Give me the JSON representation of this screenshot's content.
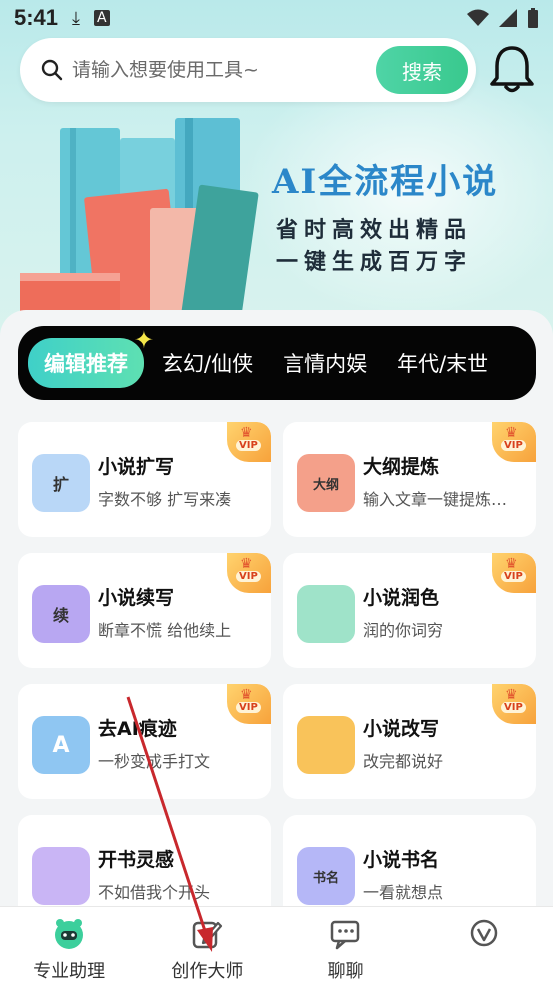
{
  "status_bar": {
    "time": "5:41"
  },
  "search": {
    "placeholder": "请输入想要使用工具~",
    "button_label": "搜索"
  },
  "banner": {
    "title": "AI全流程小说",
    "line1": "省时高效出精品",
    "line2": "一键生成百万字"
  },
  "tabs": [
    {
      "label": "编辑推荐",
      "active": true
    },
    {
      "label": "玄幻/仙侠"
    },
    {
      "label": "言情内娱"
    },
    {
      "label": "年代/末世"
    }
  ],
  "cards": [
    {
      "title": "小说扩写",
      "desc": "字数不够 扩写来凑",
      "badge": "VIP",
      "thumb_text": "扩",
      "thumb_color": "#b9d7f7"
    },
    {
      "title": "大纲提炼",
      "desc": "输入文章一键提炼…",
      "badge": "VIP",
      "thumb_text": "大纲",
      "thumb_color": "#f4a08a"
    },
    {
      "title": "小说续写",
      "desc": "断章不慌 给他续上",
      "badge": "VIP",
      "thumb_text": "续",
      "thumb_color": "#b8a7f2"
    },
    {
      "title": "小说润色",
      "desc": "润的你词穷",
      "badge": "VIP",
      "thumb_text": "",
      "thumb_color": "#9fe3c9"
    },
    {
      "title": "去AI痕迹",
      "desc": "一秒变成手打文",
      "badge": "VIP",
      "thumb_text": "A",
      "thumb_color": "#8fc6f2"
    },
    {
      "title": "小说改写",
      "desc": "改完都说好",
      "badge": "VIP",
      "thumb_text": "",
      "thumb_color": "#f9c35a"
    },
    {
      "title": "开书灵感",
      "desc": "不如借我个开头",
      "badge": "",
      "thumb_text": "",
      "thumb_color": "#c9b5f5"
    },
    {
      "title": "小说书名",
      "desc": "一看就想点",
      "badge": "",
      "thumb_text": "书名",
      "thumb_color": "#b5b7f7"
    }
  ],
  "bottom_nav": [
    {
      "label": "专业助理",
      "icon": "robot-icon",
      "active": true
    },
    {
      "label": "创作大师",
      "icon": "pen-icon"
    },
    {
      "label": "聊聊",
      "icon": "chat-icon"
    },
    {
      "label": "",
      "icon": "profile-icon"
    }
  ],
  "colors": {
    "accent": "#3fd0a8",
    "annotation_arrow": "#c8282d"
  }
}
